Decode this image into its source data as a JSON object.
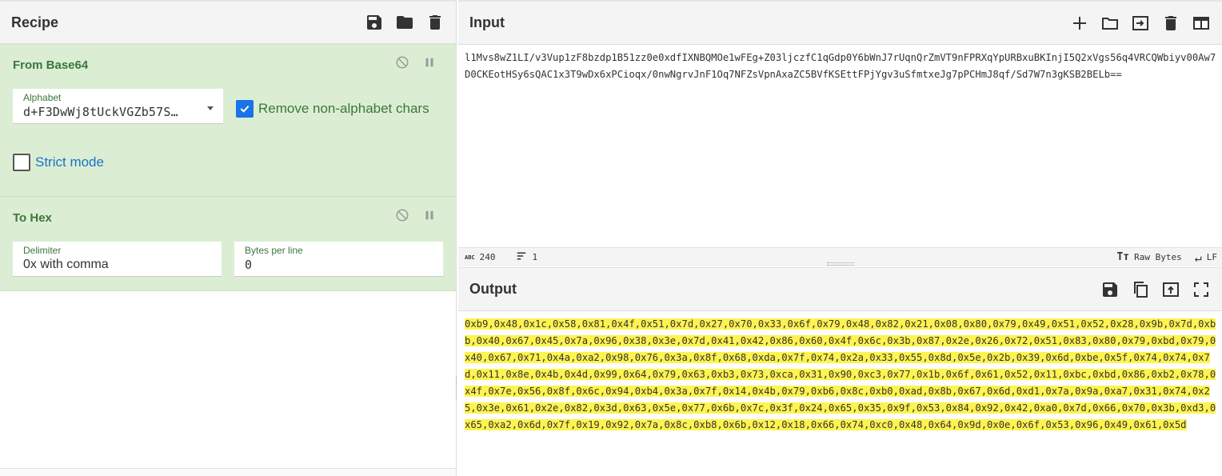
{
  "recipe": {
    "title": "Recipe",
    "header_icons": [
      "save-icon",
      "folder-icon",
      "trash-icon"
    ],
    "operations": [
      {
        "title": "From Base64",
        "alphabet_label": "Alphabet",
        "alphabet_value": "d+F3DwWj8tUckVGZb57S…",
        "remove_label": "Remove non-alphabet chars",
        "remove_checked": true,
        "strict_label": "Strict mode",
        "strict_checked": false
      },
      {
        "title": "To Hex",
        "delimiter_label": "Delimiter",
        "delimiter_value": "0x with comma",
        "bytes_label": "Bytes per line",
        "bytes_value": "0"
      }
    ]
  },
  "input": {
    "title": "Input",
    "text": "l1Mvs8wZ1LI/v3Vup1zF8bzdp1B51zz0e0xdfIXNBQMOe1wFEg+Z03ljczfC1qGdp0Y6bWnJ7rUqnQrZmVT9nFPRXqYpURBxuBKInjI5Q2xVgs56q4VRCQWbiyv00Aw7D0CKEotHSy6sQAC1x3T9wDx6xPCioqx/0nwNgrvJnF1Oq7NFZsVpnAxaZC5BVfKSEttFPjYgv3uSfmtxeJg7pPCHmJ8qf/Sd7W7n3gKSB2BELb==",
    "status": {
      "length": "240",
      "lines": "1",
      "encoding": "Raw Bytes",
      "eol": "LF"
    }
  },
  "output": {
    "title": "Output",
    "text": "0xb9,0x48,0x1c,0x58,0x81,0x4f,0x51,0x7d,0x27,0x70,0x33,0x6f,0x79,0x48,0x82,0x21,0x08,0x80,0x79,0x49,0x51,0x52,0x28,0x9b,0x7d,0xbb,0x40,0x67,0x45,0x7a,0x96,0x38,0x3e,0x7d,0x41,0x42,0x86,0x60,0x4f,0x6c,0x3b,0x87,0x2e,0x26,0x72,0x51,0x83,0x80,0x79,0xbd,0x79,0x40,0x67,0x71,0x4a,0xa2,0x98,0x76,0x3a,0x8f,0x68,0xda,0x7f,0x74,0x2a,0x33,0x55,0x8d,0x5e,0x2b,0x39,0x6d,0xbe,0x5f,0x74,0x74,0x7d,0x11,0x8e,0x4b,0x4d,0x99,0x64,0x79,0x63,0xb3,0x73,0xca,0x31,0x90,0xc3,0x77,0x1b,0x6f,0x61,0x52,0x11,0xbc,0xbd,0x86,0xb2,0x78,0x4f,0x7e,0x56,0x8f,0x6c,0x94,0xb4,0x3a,0x7f,0x14,0x4b,0x79,0xb6,0x8c,0xb0,0xad,0x8b,0x67,0x6d,0xd1,0x7a,0x9a,0xa7,0x31,0x74,0x25,0x3e,0x61,0x2e,0x82,0x3d,0x63,0x5e,0x77,0x6b,0x7c,0x3f,0x24,0x65,0x35,0x9f,0x53,0x84,0x92,0x42,0xa0,0x7d,0x66,0x70,0x3b,0xd3,0x65,0xa2,0x6d,0x7f,0x19,0x92,0x7a,0x8c,0xb8,0x6b,0x12,0x18,0x66,0x74,0xc0,0x48,0x64,0x9d,0x0e,0x6f,0x53,0x96,0x49,0x61,0x5d"
  },
  "colors": {
    "op_bg": "#dbeed3",
    "op_text": "#3c763d",
    "checkbox": "#1a73e8",
    "highlight": "#fff34f"
  }
}
